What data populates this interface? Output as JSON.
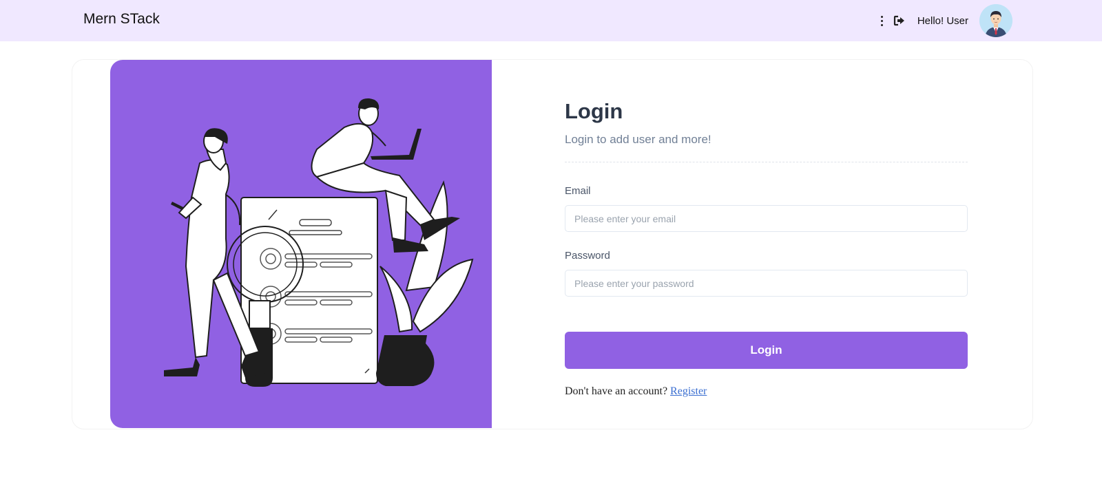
{
  "navbar": {
    "brand": "Mern STack",
    "greeting": "Hello! User",
    "icons": [
      "more-vertical-icon",
      "logout-icon"
    ],
    "bg_color": "#f0e8ff"
  },
  "login": {
    "title": "Login",
    "subtitle": "Login to add user and more!",
    "email_label": "Email",
    "email_placeholder": "Please enter your email",
    "email_value": "",
    "password_label": "Password",
    "password_placeholder": "Please enter your password",
    "password_value": "",
    "submit_label": "Login",
    "register_prompt": "Don't have an account?",
    "register_link": "Register"
  },
  "colors": {
    "accent": "#9061e3",
    "navbar": "#f0e8ff",
    "title": "#2d3748",
    "link": "#3b6fd1"
  }
}
